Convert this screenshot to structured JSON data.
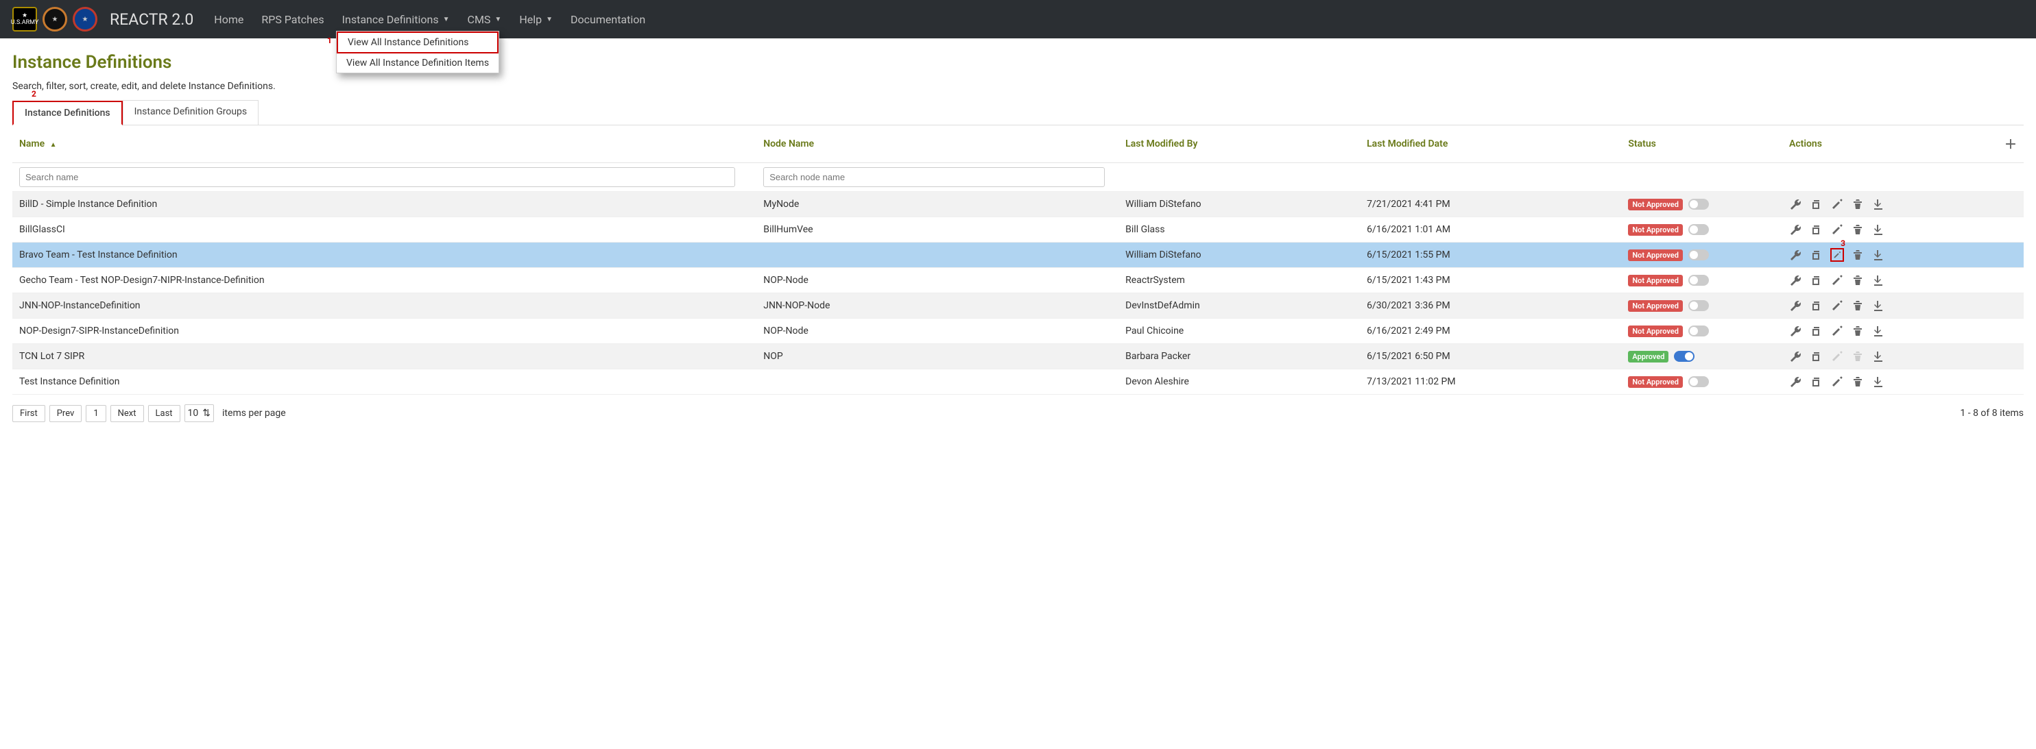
{
  "brand": "REACTR 2.0",
  "logos": {
    "army": "U.S.ARMY",
    "star": "★",
    "redstar": "★"
  },
  "nav": {
    "home": "Home",
    "rps": "RPS Patches",
    "instdef": "Instance Definitions",
    "cms": "CMS",
    "help": "Help",
    "doc": "Documentation"
  },
  "dropdown": {
    "view_all": "View All Instance Definitions",
    "view_items": "View All Instance Definition Items",
    "annot1": "1"
  },
  "page": {
    "title": "Instance Definitions",
    "subtitle": "Search, filter, sort, create, edit, and delete Instance Definitions."
  },
  "tabs": {
    "defs": "Instance Definitions",
    "groups": "Instance Definition Groups",
    "annot2": "2"
  },
  "columns": {
    "name": "Name",
    "node": "Node Name",
    "modby": "Last Modified By",
    "moddate": "Last Modified Date",
    "status": "Status",
    "actions": "Actions"
  },
  "filters": {
    "name_ph": "Search name",
    "node_ph": "Search node name"
  },
  "status_labels": {
    "not_approved": "Not Approved",
    "approved": "Approved"
  },
  "annot3": "3",
  "rows": [
    {
      "name": "BillD - Simple Instance Definition",
      "node": "MyNode",
      "modby": "William DiStefano",
      "moddate": "7/21/2021 4:41 PM",
      "approved": false
    },
    {
      "name": "BillGlassCI",
      "node": "BillHumVee",
      "modby": "Bill Glass",
      "moddate": "6/16/2021 1:01 AM",
      "approved": false
    },
    {
      "name": "Bravo Team - Test Instance Definition",
      "node": "",
      "modby": "William DiStefano",
      "moddate": "6/15/2021 1:55 PM",
      "approved": false,
      "selected": true,
      "edit_highlight": true
    },
    {
      "name": "Gecho Team - Test NOP-Design7-NIPR-Instance-Definition",
      "node": "NOP-Node",
      "modby": "ReactrSystem",
      "moddate": "6/15/2021 1:43 PM",
      "approved": false
    },
    {
      "name": "JNN-NOP-InstanceDefinition",
      "node": "JNN-NOP-Node",
      "modby": "DevInstDefAdmin",
      "moddate": "6/30/2021 3:36 PM",
      "approved": false
    },
    {
      "name": "NOP-Design7-SIPR-InstanceDefinition",
      "node": "NOP-Node",
      "modby": "Paul Chicoine",
      "moddate": "6/16/2021 2:49 PM",
      "approved": false
    },
    {
      "name": "TCN Lot 7 SIPR",
      "node": "NOP",
      "modby": "Barbara Packer",
      "moddate": "6/15/2021 6:50 PM",
      "approved": true
    },
    {
      "name": "Test Instance Definition",
      "node": "",
      "modby": "Devon Aleshire",
      "moddate": "7/13/2021 11:02 PM",
      "approved": false
    }
  ],
  "pager": {
    "first": "First",
    "prev": "Prev",
    "page": "1",
    "next": "Next",
    "last": "Last",
    "size": "10",
    "ipp": "items per page",
    "count": "1 - 8 of 8 items"
  }
}
